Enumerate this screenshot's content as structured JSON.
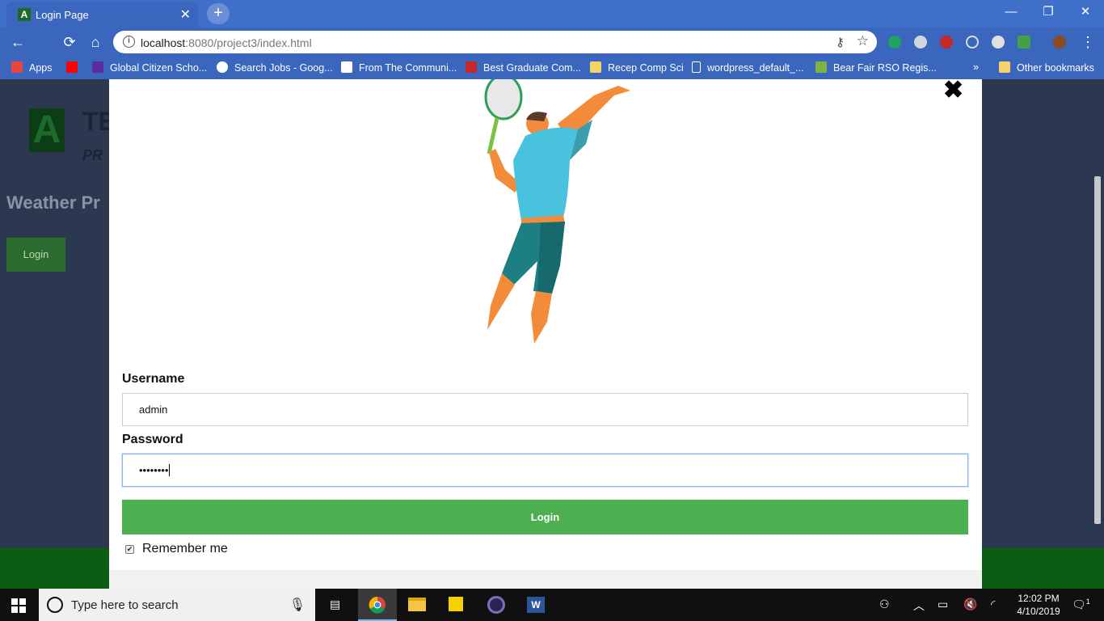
{
  "browser": {
    "tab_title": "Login Page",
    "tab_favicon": "A",
    "url_host": "localhost",
    "url_rest": ":8080/project3/index.html",
    "window_controls": {
      "minimize": "—",
      "restore": "❐",
      "close": "✕"
    }
  },
  "bookmarks": [
    {
      "label": "Apps",
      "icon": "apps-grid-icon",
      "color": "#e8453c"
    },
    {
      "label": "",
      "icon": "youtube-icon",
      "color": "#ff0000"
    },
    {
      "label": "Global Citizen Scho...",
      "icon": "bookmark-icon",
      "color": "#5b2ca0"
    },
    {
      "label": "Search Jobs - Goog...",
      "icon": "google-icon",
      "color": "#ffffff"
    },
    {
      "label": "From The Communi...",
      "icon": "amazon-icon",
      "color": "#ffffff"
    },
    {
      "label": "Best Graduate Com...",
      "icon": "usn-icon",
      "color": "#c62828"
    },
    {
      "label": "Recep Comp Sci",
      "icon": "folder-icon",
      "color": "#f6d36a"
    },
    {
      "label": "wordpress_default_...",
      "icon": "page-icon",
      "color": "#ffffff"
    },
    {
      "label": "Bear Fair RSO Regis...",
      "icon": "bear-icon",
      "color": "#7cb342"
    },
    {
      "label": "»",
      "icon": "more-icon",
      "color": "#ffffff"
    },
    {
      "label": "Other bookmarks",
      "icon": "folder-icon",
      "color": "#f6d36a"
    }
  ],
  "background_page": {
    "logo_letter": "A",
    "logo_text": "TE",
    "logo_sub": "PR",
    "title": "Weather Pr",
    "login_button": "Login"
  },
  "modal": {
    "close_symbol": "✖",
    "username_label": "Username",
    "username_value": "admin",
    "password_label": "Password",
    "password_value": "••••••••",
    "login_button": "Login",
    "remember_label": "Remember me",
    "remember_checked": true
  },
  "taskbar": {
    "search_placeholder": "Type here to search",
    "time": "12:02 PM",
    "date": "4/10/2019",
    "notification_count": "1"
  },
  "colors": {
    "chrome_blue": "#3a66bd",
    "login_green": "#4caf50",
    "page_bg": "#2b3850",
    "footer_green": "#0b5d13"
  }
}
